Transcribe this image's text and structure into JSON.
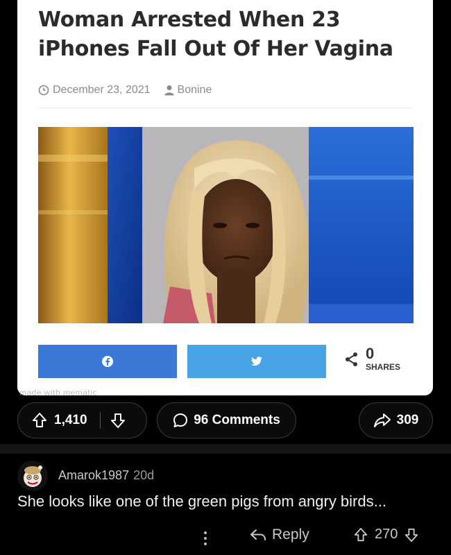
{
  "article": {
    "headline": "Woman Arrested When 23 iPhones Fall Out Of Her Vagina",
    "date": "December 23, 2021",
    "author": "Bonine",
    "facebook_icon": "facebook-icon",
    "twitter_icon": "twitter-icon",
    "shares_count": "0",
    "shares_label": "SHARES",
    "watermark": "made with mematic"
  },
  "post_actions": {
    "score": "1,410",
    "comments": "96 Comments",
    "shares": "309"
  },
  "comment": {
    "author": "Amarok1987",
    "age": "20d",
    "body": "She looks like one of the green pigs from angry birds...",
    "reply_label": "Reply",
    "score": "270"
  },
  "colors": {
    "facebook_button": "#3b78d8",
    "twitter_button": "#47a3e6",
    "background": "#000000"
  }
}
